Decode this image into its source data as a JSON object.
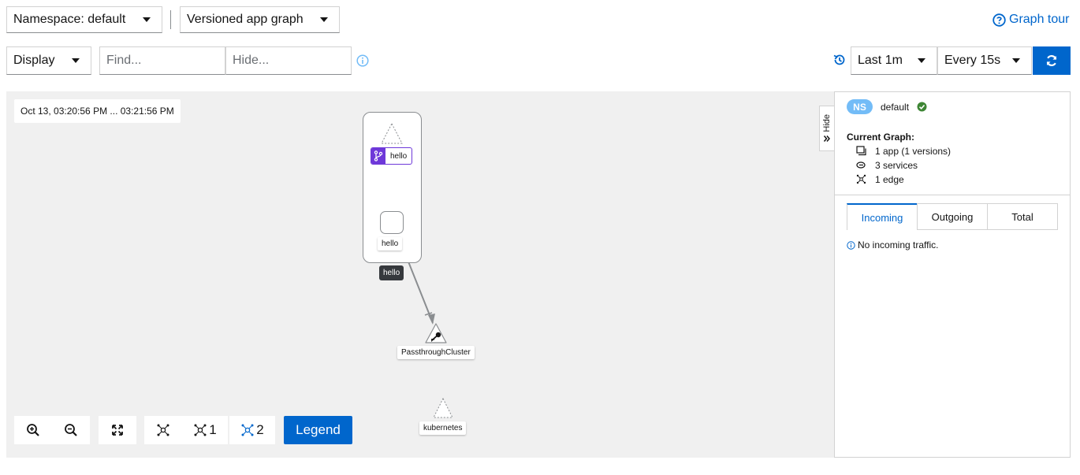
{
  "toolbar": {
    "namespace_label": "Namespace: default",
    "graph_type_label": "Versioned app graph",
    "graph_tour_label": "Graph tour",
    "display_label": "Display",
    "find_placeholder": "Find...",
    "hide_placeholder": "Hide...",
    "duration_label": "Last 1m",
    "refresh_interval_label": "Every 15s"
  },
  "graph": {
    "time_range": "Oct 13, 03:20:56 PM ... 03:21:56 PM",
    "nodes": {
      "hello_app_version": "hello",
      "hello_workload": "hello",
      "hello_box": "hello",
      "passthrough": "PassthroughCluster",
      "kubernetes": "kubernetes"
    },
    "controls": {
      "layout_1_label": "1",
      "layout_2_label": "2",
      "legend_label": "Legend"
    }
  },
  "side_panel": {
    "hide_label": "Hide",
    "ns_badge": "NS",
    "namespace": "default",
    "current_graph_title": "Current Graph:",
    "apps": "1 app (1 versions)",
    "services": "3 services",
    "edges": "1 edge",
    "tabs": [
      "Incoming",
      "Outgoing",
      "Total"
    ],
    "no_traffic": "No incoming traffic."
  },
  "colors": {
    "primary": "#0066cc",
    "graph_bg": "#f0f0f0",
    "version_badge": "#6e38d9",
    "healthy": "#3e8635",
    "ns_badge": "#73bcf7"
  }
}
